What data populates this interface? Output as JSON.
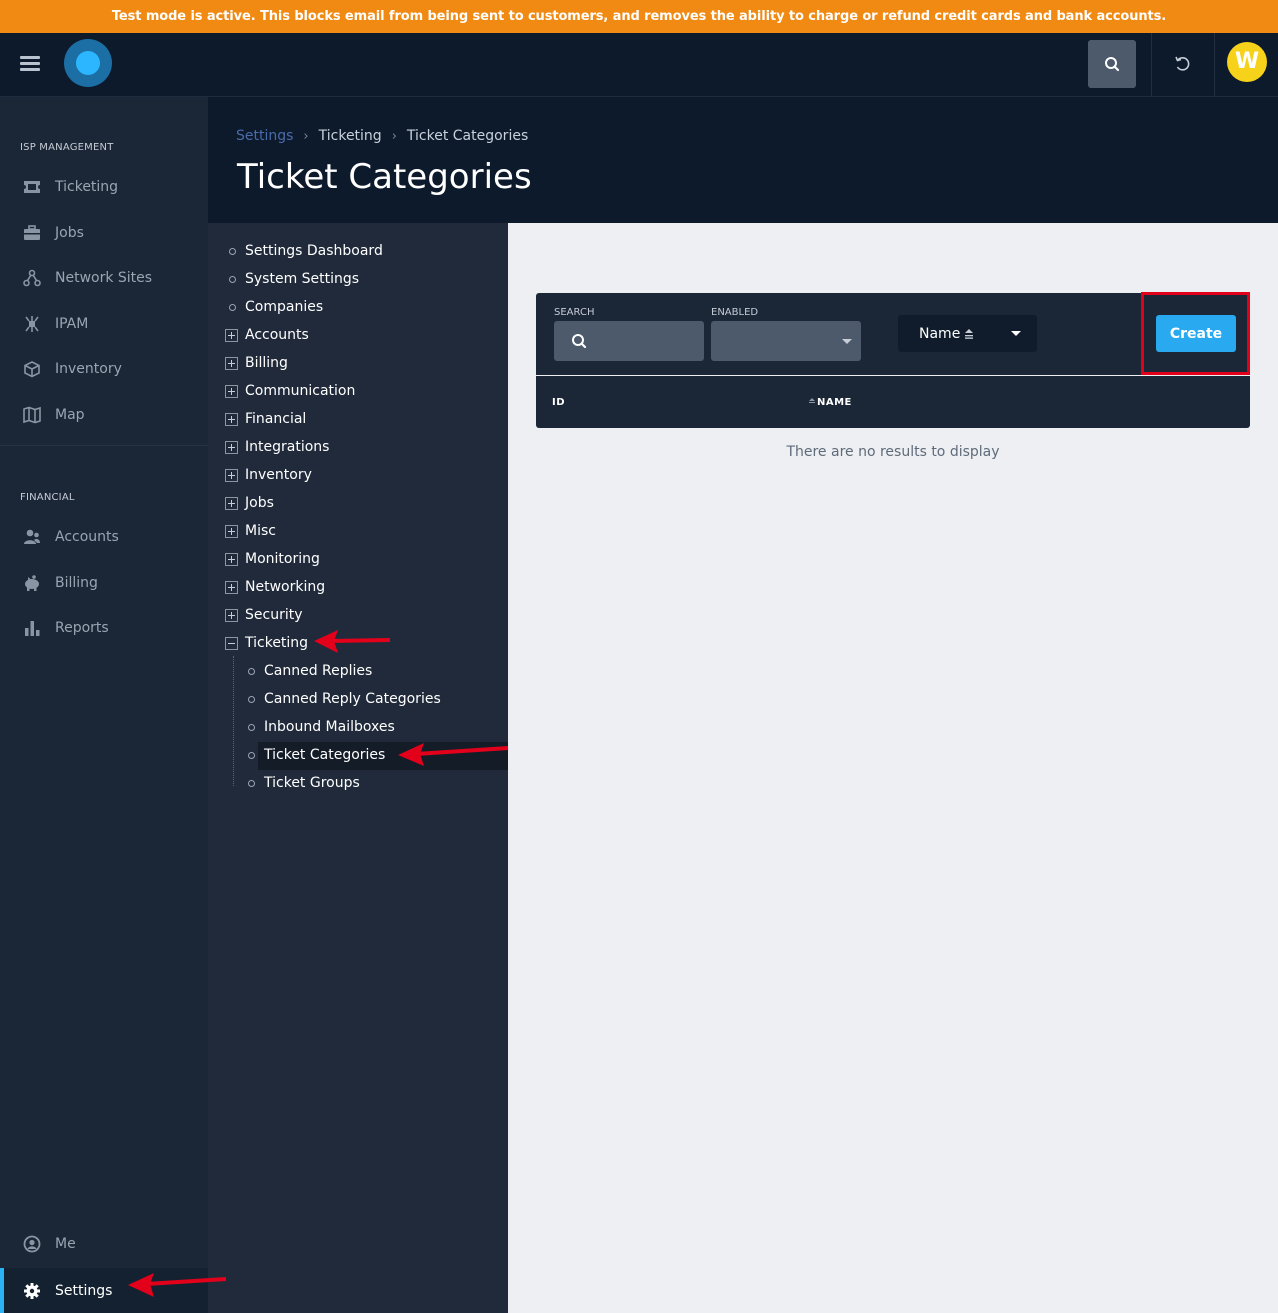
{
  "banner": {
    "text": "Test mode is active. This blocks email from being sent to customers, and removes the ability to charge or refund credit cards and bank accounts."
  },
  "topbar": {
    "avatar_letter": "W",
    "icons": [
      "menu-icon",
      "logo",
      "search-icon",
      "history-icon"
    ]
  },
  "sidebar": {
    "sections": [
      {
        "label": "ISP MANAGEMENT",
        "items": [
          {
            "label": "Ticketing",
            "icon": "ticket-icon"
          },
          {
            "label": "Jobs",
            "icon": "briefcase-icon"
          },
          {
            "label": "Network Sites",
            "icon": "network-icon"
          },
          {
            "label": "IPAM",
            "icon": "ipam-icon"
          },
          {
            "label": "Inventory",
            "icon": "box-icon"
          },
          {
            "label": "Map",
            "icon": "map-icon"
          }
        ]
      },
      {
        "label": "FINANCIAL",
        "items": [
          {
            "label": "Accounts",
            "icon": "users-icon"
          },
          {
            "label": "Billing",
            "icon": "piggy-bank-icon"
          },
          {
            "label": "Reports",
            "icon": "bar-chart-icon"
          }
        ]
      }
    ],
    "bottom": [
      {
        "label": "Me",
        "icon": "user-circle-icon"
      },
      {
        "label": "Settings",
        "icon": "gear-icon",
        "active": true
      }
    ]
  },
  "header": {
    "breadcrumbs": [
      "Settings",
      "Ticketing",
      "Ticket Categories"
    ],
    "title": "Ticket Categories"
  },
  "tree": {
    "top_items": [
      "Settings Dashboard",
      "System Settings",
      "Companies"
    ],
    "groups": [
      "Accounts",
      "Billing",
      "Communication",
      "Financial",
      "Integrations",
      "Inventory",
      "Jobs",
      "Misc",
      "Monitoring",
      "Networking",
      "Security"
    ],
    "expanded": {
      "label": "Ticketing",
      "children": [
        "Canned Replies",
        "Canned Reply Categories",
        "Inbound Mailboxes",
        "Ticket Categories",
        "Ticket Groups"
      ],
      "selected": "Ticket Categories"
    }
  },
  "toolbar": {
    "search_label": "SEARCH",
    "enabled_label": "ENABLED",
    "sort_value": "Name",
    "create_label": "Create"
  },
  "table": {
    "columns": [
      "ID",
      "NAME"
    ],
    "empty_text": "There are no results to display"
  },
  "colors": {
    "banner": "#f08a12",
    "accent": "#29aaf0",
    "annotation": "#e3001b"
  }
}
